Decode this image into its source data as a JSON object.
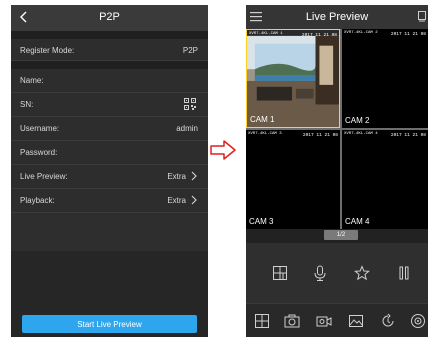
{
  "p2p_screen": {
    "title": "P2P",
    "rows": [
      {
        "label": "Register Mode:",
        "value": "P2P"
      },
      {
        "label": "Name:",
        "value": ""
      },
      {
        "label": "SN:",
        "value": ""
      },
      {
        "label": "Username:",
        "value": "admin"
      },
      {
        "label": "Password:",
        "value": ""
      },
      {
        "label": "Live Preview:",
        "value": "Extra"
      },
      {
        "label": "Playback:",
        "value": "Extra"
      }
    ],
    "start_button": "Start Live Preview"
  },
  "live_screen": {
    "title": "Live Preview",
    "cameras": [
      {
        "info": "XVR7-4KL-CAM 1",
        "time": "2017 11 21 08",
        "name": "CAM 1"
      },
      {
        "info": "XVR7-4KL-CAM 2",
        "time": "2017 11 21 08",
        "name": "CAM 2"
      },
      {
        "info": "XVR7-4KL-CAM 3",
        "time": "2017 11 21 08",
        "name": "CAM 3"
      },
      {
        "info": "XVR7-4KL-CAM 4",
        "time": "2017 11 21 08",
        "name": "CAM 4"
      }
    ],
    "page_indicator": "1/2"
  },
  "colors": {
    "accent": "#2ea6ee",
    "arrow": "#e02020",
    "active_border": "#ffd21f"
  },
  "icons": [
    "back-icon",
    "qr-code-icon",
    "chevron-right-icon",
    "menu-icon",
    "device-icon",
    "split-screen-icon",
    "microphone-icon",
    "star-icon",
    "pause-icon",
    "grid-layout-icon",
    "snapshot-icon",
    "record-icon",
    "image-icon",
    "playback-icon",
    "ptz-icon"
  ]
}
